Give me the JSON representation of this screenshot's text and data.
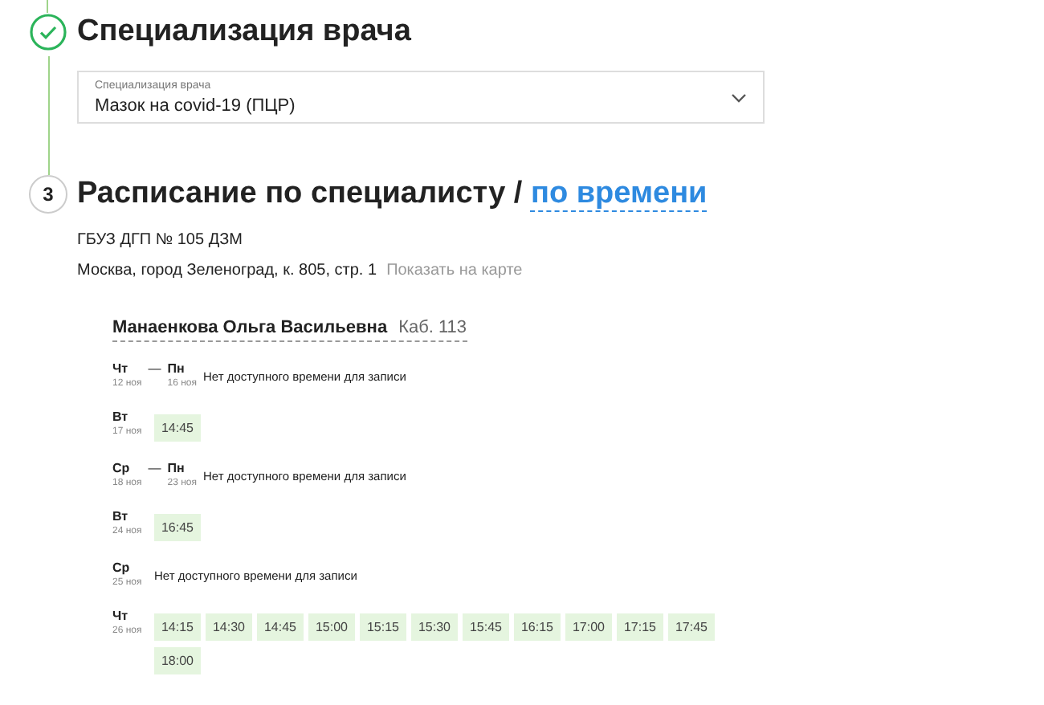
{
  "steps": [
    {
      "kind": "done",
      "title": "Специализация врача"
    },
    {
      "kind": "number",
      "number": "3",
      "title": "Расписание по специалисту / ",
      "link": "по времени"
    }
  ],
  "select": {
    "label": "Специализация врача",
    "value": "Мазок на covid-19 (ПЦР)"
  },
  "clinic": {
    "name": "ГБУЗ ДГП № 105 ДЗМ",
    "address": "Москва, город Зеленоград, к. 805, стр. 1",
    "map_link": "Показать на карте"
  },
  "doctor": {
    "name": "Манаенкова Ольга Васильевна",
    "room": "Каб. 113"
  },
  "days": [
    {
      "kind": "range",
      "separator": "—",
      "days": [
        {
          "day": "Чт",
          "date": "12 ноя"
        },
        {
          "day": "Пн",
          "date": "16 ноя"
        }
      ],
      "message": "Нет доступного времени для записи"
    },
    {
      "kind": "single",
      "days": [
        {
          "day": "Вт",
          "date": "17 ноя"
        }
      ],
      "slots": [
        "14:45"
      ]
    },
    {
      "kind": "range",
      "separator": "—",
      "days": [
        {
          "day": "Ср",
          "date": "18 ноя"
        },
        {
          "day": "Пн",
          "date": "23 ноя"
        }
      ],
      "message": "Нет доступного времени для записи"
    },
    {
      "kind": "single",
      "days": [
        {
          "day": "Вт",
          "date": "24 ноя"
        }
      ],
      "slots": [
        "16:45"
      ]
    },
    {
      "kind": "single",
      "days": [
        {
          "day": "Ср",
          "date": "25 ноя"
        }
      ],
      "message": "Нет доступного времени для записи"
    },
    {
      "kind": "single",
      "days": [
        {
          "day": "Чт",
          "date": "26 ноя"
        }
      ],
      "slots": [
        "14:15",
        "14:30",
        "14:45",
        "15:00",
        "15:15",
        "15:30",
        "15:45",
        "16:15",
        "17:00",
        "17:15",
        "17:45",
        "18:00"
      ]
    }
  ]
}
